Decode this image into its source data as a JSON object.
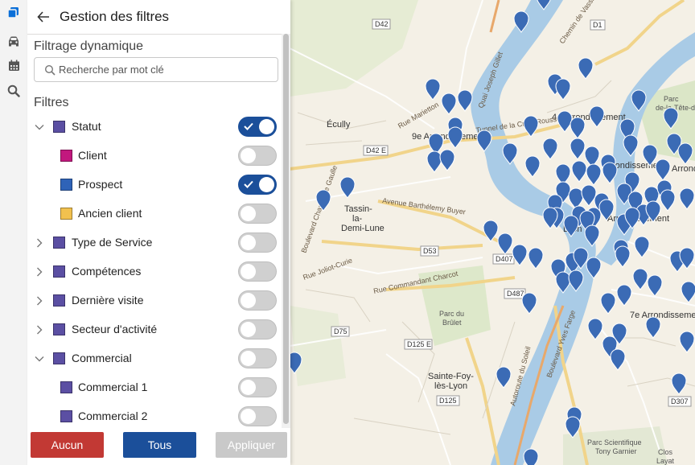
{
  "sidebar_icons": [
    "layers-icon",
    "car-icon",
    "calendar-icon",
    "search-icon"
  ],
  "panel": {
    "title": "Gestion des filtres",
    "dynamic_title": "Filtrage dynamique",
    "search_placeholder": "Recherche par mot clé",
    "filters_title": "Filtres"
  },
  "filters": [
    {
      "label": "Statut",
      "level": 0,
      "chevron": "down",
      "color": "#5b4fa3",
      "on": true
    },
    {
      "label": "Client",
      "level": 1,
      "color": "#c2187e",
      "on": false
    },
    {
      "label": "Prospect",
      "level": 1,
      "color": "#2f63b8",
      "on": true
    },
    {
      "label": "Ancien client",
      "level": 1,
      "color": "#f2c14e",
      "on": false
    },
    {
      "label": "Type de Service",
      "level": 0,
      "chevron": "right",
      "color": "#5b4fa3",
      "on": false
    },
    {
      "label": "Compétences",
      "level": 0,
      "chevron": "right",
      "color": "#5b4fa3",
      "on": false
    },
    {
      "label": "Dernière visite",
      "level": 0,
      "chevron": "right",
      "color": "#5b4fa3",
      "on": false
    },
    {
      "label": "Secteur d'activité",
      "level": 0,
      "chevron": "right",
      "color": "#5b4fa3",
      "on": false
    },
    {
      "label": "Commercial",
      "level": 0,
      "chevron": "down",
      "color": "#5b4fa3",
      "on": false
    },
    {
      "label": "Commercial 1",
      "level": 1,
      "color": "#5b4fa3",
      "on": false
    },
    {
      "label": "Commercial 2",
      "level": 1,
      "color": "#5b4fa3",
      "on": false
    }
  ],
  "footer": {
    "cancel": "Aucun",
    "all": "Tous",
    "apply": "Appliquer"
  },
  "colors": {
    "cancel": "#c23934",
    "all": "#1b4f9a",
    "apply_disabled": "#c9c9c9",
    "marker": "#3b6bb5"
  },
  "map_labels": [
    "Écully",
    "9e Arrondissement",
    "4e Arrondissement",
    "Tassin-\nla-\nDemi-Lune",
    "Lyon",
    "7e Arrondissement",
    "Sainte-Foy-\nlès-Lyon",
    "Parc du\nBrûlet",
    "Parc\nde-la-Tête-d'Or",
    "Parc Scientifique\nTony Garnier",
    "Clos\nLayat",
    "Arrondissement",
    "Arrondissement",
    "Arrondissement",
    "D42",
    "D1",
    "D42 E",
    "D53",
    "D407",
    "D487",
    "D75",
    "D125 E",
    "D125",
    "D307",
    "Tunnel de la Croix-Rousse",
    "Avenue Barthélemy Buyer",
    "Rue Commandant Charcot",
    "Boulevard Yves Farge",
    "Quai Joseph Gillet",
    "Rue Marietton",
    "Autoroute du Soleil",
    "Boulevard Charles de Gaulle",
    "Rue Joliot-Curie",
    "Chemin de Vassieux"
  ]
}
